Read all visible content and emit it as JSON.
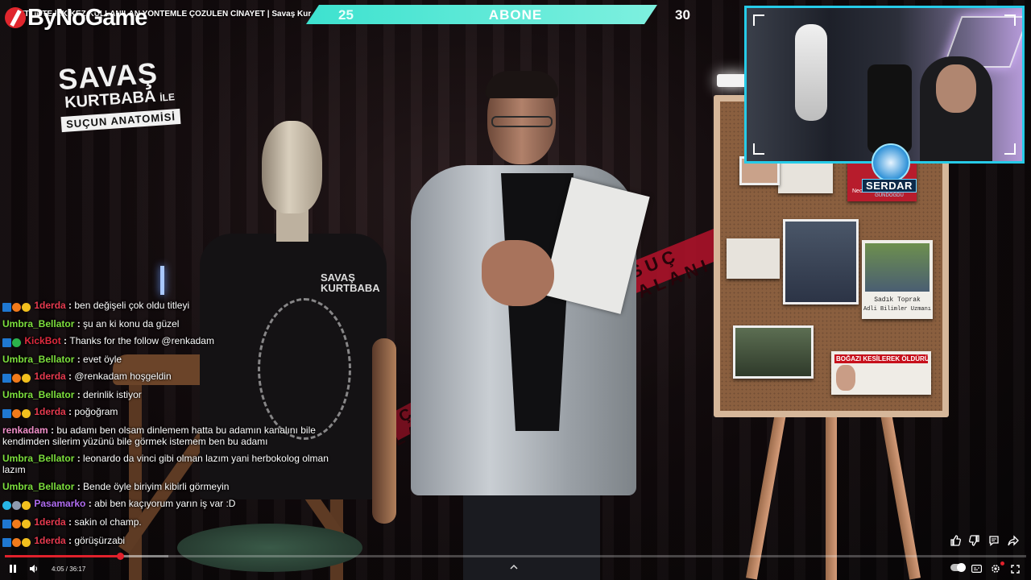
{
  "channel": {
    "name": "ByNoGame"
  },
  "video": {
    "title": "ÇİFTLİKTE İLK KEZ KULLANILAN YÖNTEMLE ÇÖZÜLEN CİNAYET | Savaş Kurtbaba İle Suçun Anatomisi",
    "show_logo": {
      "line1": "SAVAŞ",
      "line2": "KURTBABA",
      "line2_suffix": "İLE",
      "line3": "SUÇUN ANATOMİSİ"
    },
    "mannequin_shirt_text": "SAVAŞ KURTBABA",
    "board": {
      "person_name": "Sadık Toprak",
      "person_title": "Adli Bilimler Uzmanı",
      "news_headline": "BOĞAZI KESİLEREK ÖLDÜRÜLDÜ",
      "clip_name": "Necı"
    },
    "tape_text": "SUÇ ALANI"
  },
  "subscriber_goal": {
    "current": "25",
    "label": "ABONE",
    "goal": "30",
    "progress_fraction": 0.833,
    "colors": {
      "bar": "#3de2cf"
    }
  },
  "webcam": {
    "badge_name": "SERDAR",
    "badge_sub": "GÜNDOĞDU",
    "frame_color": "#26cbe8"
  },
  "chat": [
    {
      "badges": [
        "twitch",
        "orange",
        "gold"
      ],
      "user": "1derda",
      "color": "#e63a4f",
      "text": "ben değişeli çok oldu titleyi"
    },
    {
      "badges": [],
      "user": "Umbra_Bellator",
      "color": "#7ddf3d",
      "text": "şu an ki konu da güzel"
    },
    {
      "badges": [
        "twitch",
        "verified"
      ],
      "user": "KickBot",
      "color": "#e02a3e",
      "text": "Thanks for the follow @renkadam"
    },
    {
      "badges": [],
      "user": "Umbra_Bellator",
      "color": "#7ddf3d",
      "text": "evet öyle"
    },
    {
      "badges": [
        "twitch",
        "orange",
        "gold"
      ],
      "user": "1derda",
      "color": "#e63a4f",
      "text": "@renkadam hoşgeldin"
    },
    {
      "badges": [],
      "user": "Umbra_Bellator",
      "color": "#7ddf3d",
      "text": "derinlik istiyor"
    },
    {
      "badges": [
        "twitch",
        "orange",
        "gold"
      ],
      "user": "1derda",
      "color": "#e63a4f",
      "text": "poğoğram"
    },
    {
      "badges": [],
      "user": "renkadam",
      "color": "#f08ec8",
      "text": "bu adamı ben olsam dinlemem hatta bu adamın kanalını bile kendimden silerim yüzünü bile görmek istemem ben bu adamı"
    },
    {
      "badges": [],
      "user": "Umbra_Bellator",
      "color": "#7ddf3d",
      "text": "leonardo da vinci gibi olman lazım yani herbokolog olman lazım"
    },
    {
      "badges": [],
      "user": "Umbra_Bellator",
      "color": "#7ddf3d",
      "text": "Bende öyle biriyim kibirli görmeyin"
    },
    {
      "badges": [
        "cyan",
        "gray",
        "gold"
      ],
      "user": "Pasamarko",
      "color": "#b06cf0",
      "text": "abi ben kaçıyorum yarın iş var :D"
    },
    {
      "badges": [
        "twitch",
        "orange",
        "gold"
      ],
      "user": "1derda",
      "color": "#e63a4f",
      "text": "sakin ol champ."
    },
    {
      "badges": [
        "twitch",
        "orange",
        "gold"
      ],
      "user": "1derda",
      "color": "#e63a4f",
      "text": "görüşürzabi"
    }
  ],
  "player": {
    "current_time": "4:05",
    "duration": "36:17",
    "time_separator": " / ",
    "progress_fraction": 0.1125,
    "buffered_fraction": 0.16,
    "accent_color": "#e1212c"
  },
  "icons": {
    "play_pause": "pause-icon",
    "volume": "volume-icon",
    "chevron": "chevron-up-icon",
    "like": "like-icon",
    "dislike": "dislike-icon",
    "comment": "comment-icon",
    "share": "share-icon",
    "autoplay": "autoplay-toggle",
    "captions": "captions-icon",
    "settings": "settings-icon",
    "fullscreen": "fullscreen-icon"
  }
}
